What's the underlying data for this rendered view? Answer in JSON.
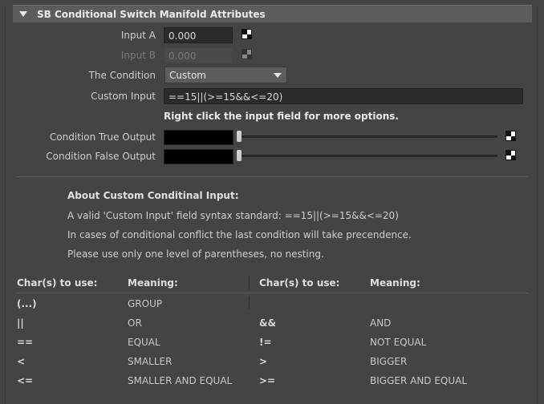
{
  "header": {
    "title": "SB Conditional Switch Manifold Attributes"
  },
  "fields": {
    "input_a": {
      "label": "Input A",
      "value": "0.000"
    },
    "input_b": {
      "label": "Input B",
      "value": "0.000"
    },
    "condition": {
      "label": "The Condition",
      "value": "Custom"
    },
    "custom_input": {
      "label": "Custom Input",
      "value": "==15||(>=15&&<=20)"
    },
    "hint": "Right click the input field for more options.",
    "true_output": {
      "label": "Condition True Output"
    },
    "false_output": {
      "label": "Condition False Output"
    }
  },
  "about": {
    "title": "About Custom Conditinal Input:",
    "lines": [
      "A valid 'Custom Input' field syntax standard: ==15||(>=15&&<=20)",
      "In cases of conditional conflict the last condition will take precendence.",
      "Please use only one level of parentheses, no nesting."
    ]
  },
  "table": {
    "headers": [
      "Char(s) to use:",
      "Meaning:",
      "Char(s) to use:",
      "Meaning:"
    ],
    "rows": [
      [
        "(...)",
        "GROUP",
        "",
        ""
      ],
      [
        "||",
        "OR",
        "&&",
        "AND"
      ],
      [
        "==",
        "EQUAL",
        "!=",
        "NOT EQUAL"
      ],
      [
        "<",
        "SMALLER",
        ">",
        "BIGGER"
      ],
      [
        "<=",
        "SMALLER AND EQUAL",
        ">=",
        "BIGGER AND EQUAL"
      ]
    ]
  },
  "icons": {
    "checker": "checker-icon",
    "dropdown": "triangle-down-icon",
    "collapse": "triangle-down-icon"
  }
}
